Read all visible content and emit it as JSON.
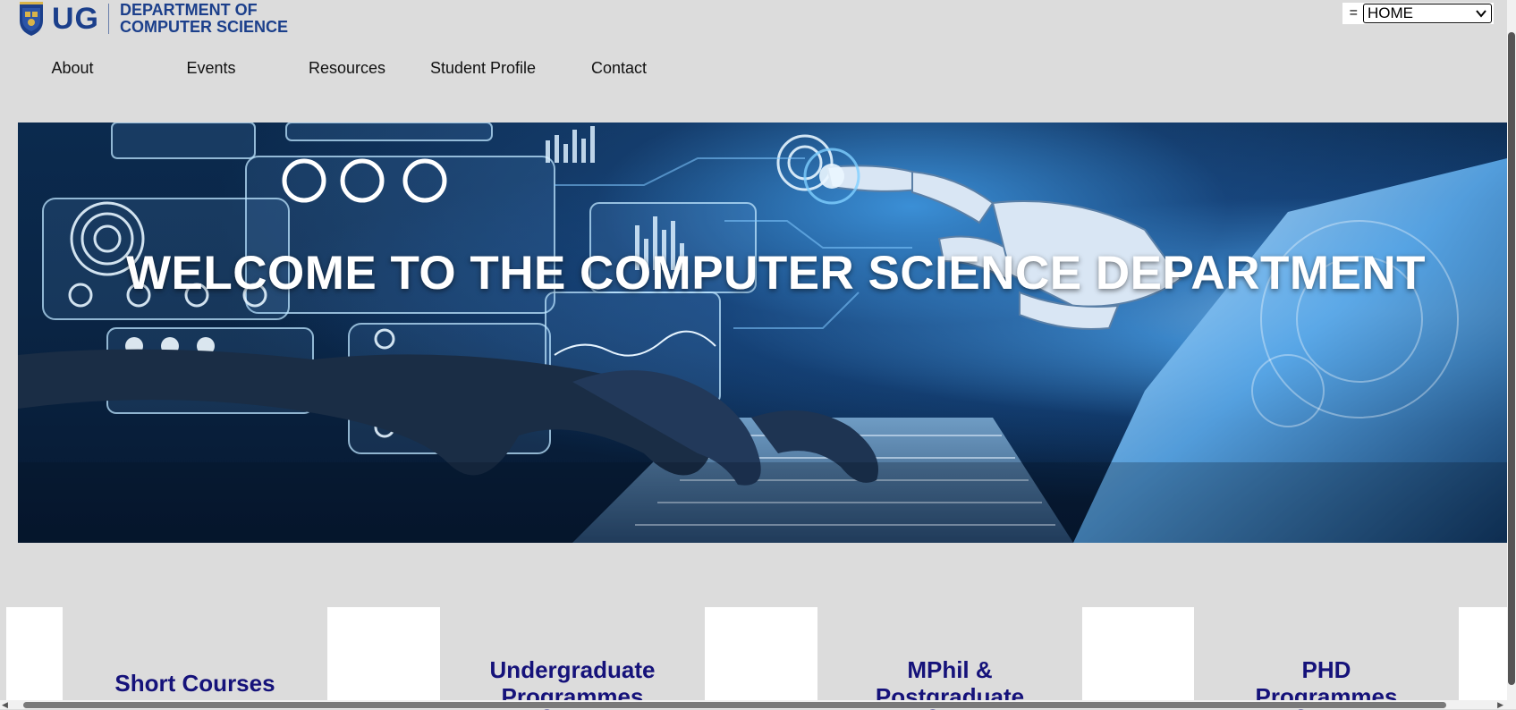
{
  "header": {
    "logo_text": "UG",
    "dept_line1": "DEPARTMENT OF",
    "dept_line2": "COMPUTER SCIENCE"
  },
  "page_select": {
    "prefix": "=",
    "selected": "HOME"
  },
  "nav": {
    "items": [
      "About",
      "Events",
      "Resources",
      "Student Profile",
      "Contact"
    ]
  },
  "hero": {
    "title": "WELCOME TO THE COMPUTER SCIENCE DEPARTMENT"
  },
  "programmes": {
    "cards": [
      {
        "line1": "Short Courses",
        "line2": ""
      },
      {
        "line1": "Undergraduate",
        "line2": "Programmes"
      },
      {
        "line1": "MPhil &",
        "line2": "Postgraduate"
      },
      {
        "line1": "PHD",
        "line2": "Programmes"
      }
    ]
  },
  "colors": {
    "background": "#dcdcdc",
    "brand_blue": "#1b3f8b",
    "card_title": "#15127a",
    "hero_text": "#ffffff"
  }
}
